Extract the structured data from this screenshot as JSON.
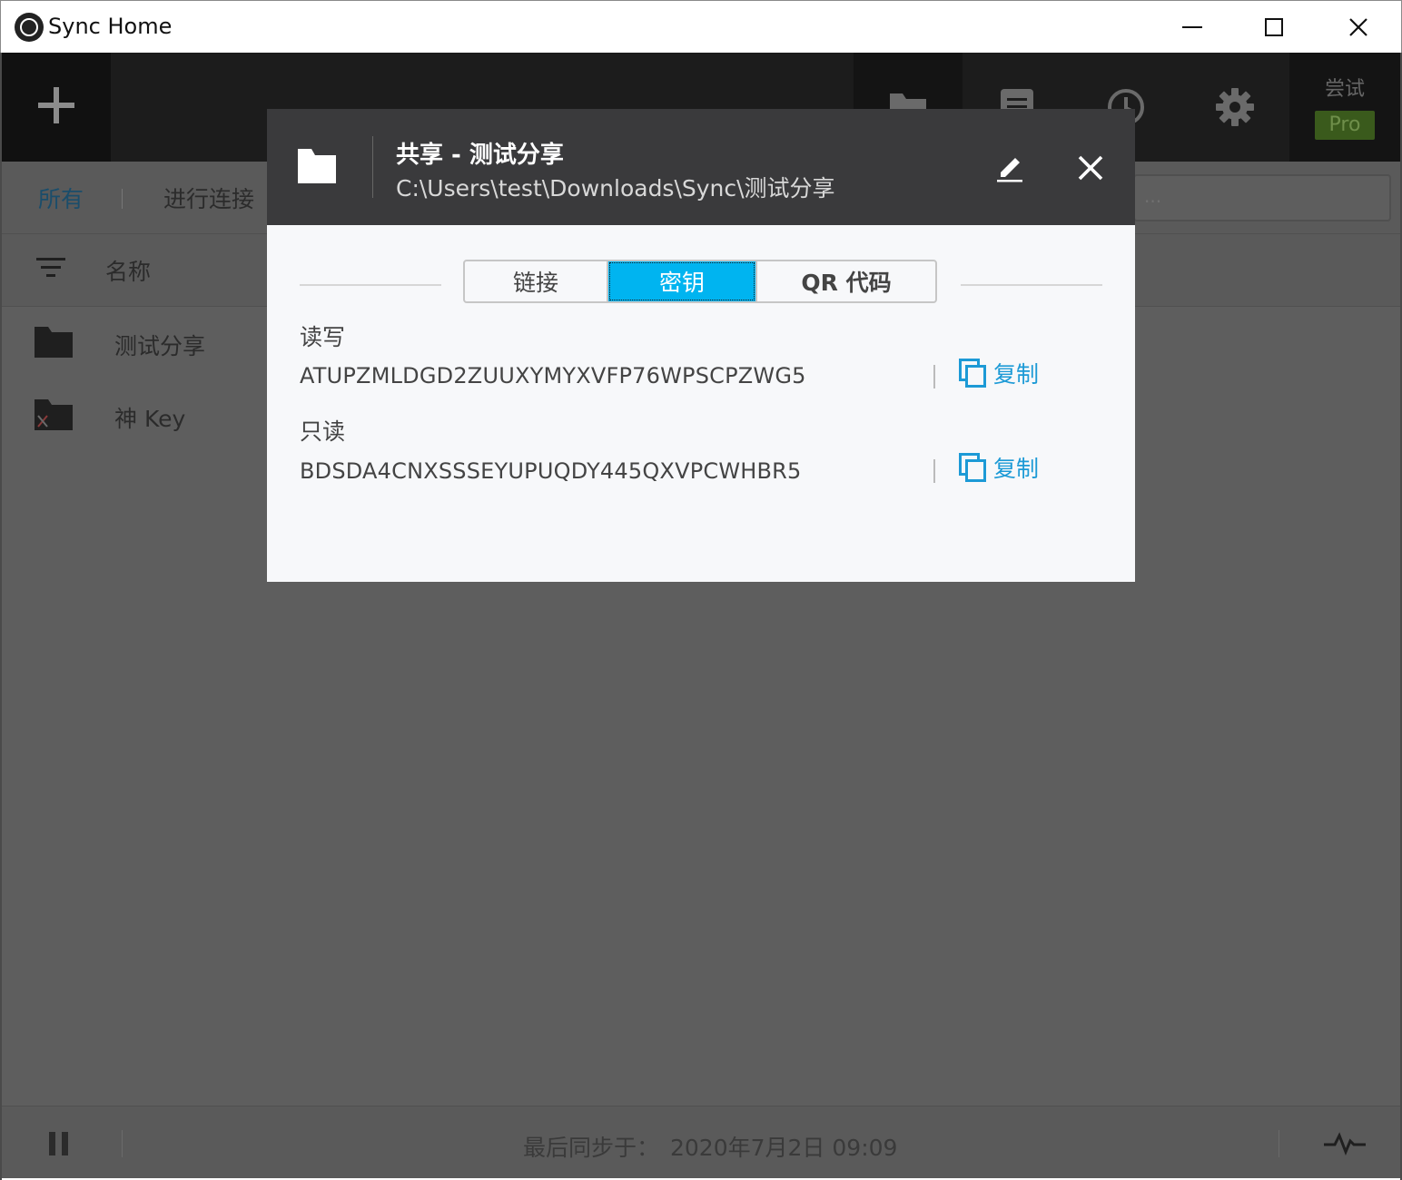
{
  "window": {
    "title": "Sync Home"
  },
  "toolbar": {
    "try_label": "尝试",
    "pro_label": "Pro"
  },
  "tabs": {
    "all": "所有",
    "connect": "进行连接"
  },
  "search": {
    "placeholder": "..."
  },
  "list": {
    "header_name": "名称",
    "items": [
      {
        "label": "测试分享",
        "icon": "folder-icon"
      },
      {
        "label": "神 Key",
        "icon": "disconnected-folder-icon"
      }
    ]
  },
  "status": {
    "last_synced_label": "最后同步于：",
    "last_synced_time": "2020年7月2日 09:09"
  },
  "dialog": {
    "title": "共享 - 测试分享",
    "path": "C:\\Users\\test\\Downloads\\Sync\\测试分享",
    "tabs": [
      "链接",
      "密钥",
      "QR 代码"
    ],
    "selected_tab": "密钥",
    "read_write_label": "读写",
    "read_write_key": "ATUPZMLDGD2ZUUXYMYXVFP76WPSCPZWG5",
    "read_only_label": "只读",
    "read_only_key": "BDSDA4CNXSSSEYUPUQDY445QXVPCWHBR5",
    "copy_label": "复制"
  },
  "colors": {
    "accent": "#00b4f0",
    "link": "#1c9ad6",
    "dialog_header": "#3a3a3c",
    "overlay": "#5e5e5e"
  }
}
